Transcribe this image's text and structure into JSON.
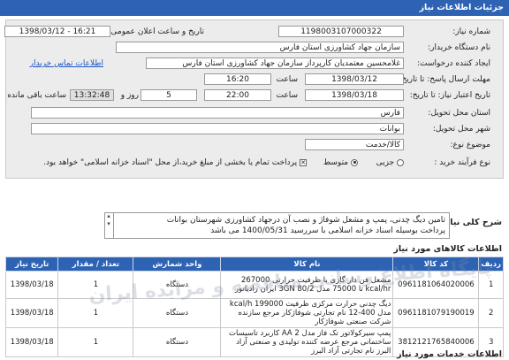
{
  "header": {
    "title": "جزئیات اطلاعات نیاز"
  },
  "form": {
    "need_number_label": "شماره نیاز:",
    "need_number": "1198003107000322",
    "announce_label": "تاریخ و ساعت اعلان عمومی:",
    "announce_value": "1398/03/12 - 16:21",
    "buyer_label": "نام دستگاه خریدار:",
    "buyer": "سازمان جهاد کشاورزی استان فارس",
    "creator_label": "ایجاد کننده درخواست:",
    "creator": "غلامحسین معتمدیان کارپرداز سازمان جهاد کشاورزی استان فارس",
    "contact_link": "اطلاعات تماس خریدار",
    "send_deadline_label": "مهلت ارسال پاسخ: تا تاریخ:",
    "send_date": "1398/03/12",
    "time_label": "ساعت",
    "send_time": "16:20",
    "validity_label": "تاریخ اعتبار نیاز: تا تاریخ:",
    "validity_date": "1398/03/18",
    "validity_time": "22:00",
    "day_label": "روز و",
    "days": "5",
    "remaining_time": "13:32:48",
    "remaining_label": "ساعت باقی مانده",
    "province_label": "استان محل تحویل:",
    "province": "فارس",
    "city_label": "شهر محل تحویل:",
    "city": "بوانات",
    "category_label": "موضوع نوع:",
    "category_options": [
      "کالا",
      "خدمت",
      "کالا/خدمت"
    ],
    "category_value": "کالا/خدمت",
    "process_label": "نوع فرآیند خرید :",
    "process_options": [
      "جزیی",
      "متوسط"
    ],
    "process_selected": "متوسط",
    "payment_note": "پرداخت تمام یا بخشی از مبلغ خرید،از محل \"اسناد خزانه اسلامی\" خواهد بود."
  },
  "summary": {
    "title": "شرح کلی نیاز:",
    "line1": "تامین دیگ چدنی، پمپ و مشعل شوفاژ و نصب آن درجهاد کشاورزی شهرستان بوانات",
    "line2": "پرداخت بوسیله اسناد خزانه اسلامی با سررسید 1400/05/31 می باشد"
  },
  "goods": {
    "title": "اطلاعات کالاهای مورد نیاز",
    "columns": [
      "ردیف",
      "کد کالا",
      "نام کالا",
      "واحد شمارش",
      "تعداد / مقدار",
      "تاریخ نیاز"
    ],
    "rows": [
      {
        "idx": "1",
        "code": "0961181064020006",
        "name": "مشعل فن دار گازی با ظرفیت حرارتی 267000 kcal/hr تا 75000 مدل 80/2 3GN ایران رادیاتور",
        "unit": "دستگاه",
        "qty": "1",
        "date": "1398/03/18"
      },
      {
        "idx": "2",
        "code": "0961181079190019",
        "name": "دیگ چدنی حرارت مرکزی ظرفیت 199000 kcal/h مدل 400-12 نام تجارتی شوفاژکار مرجع سازنده شرکت صنعتی شوفاژکار",
        "unit": "دستگاه",
        "qty": "1",
        "date": "1398/03/18"
      },
      {
        "idx": "3",
        "code": "3812121765840006",
        "name": "پمپ سیرکولاتور تک فاز مدل AA 2 کاربرد تاسیسات ساختمانی مرجع عرضه کننده تولیدی و صنعتی آزاد البرز نام تجارتی آزاد البرز",
        "unit": "دستگاه",
        "qty": "1",
        "date": "1398/03/18"
      }
    ]
  },
  "services": {
    "title": "اطلاعات خدمات مورد نیاز"
  },
  "watermark": "پایگاه اطلاع رسانی مناقصه و مزایده ایران"
}
